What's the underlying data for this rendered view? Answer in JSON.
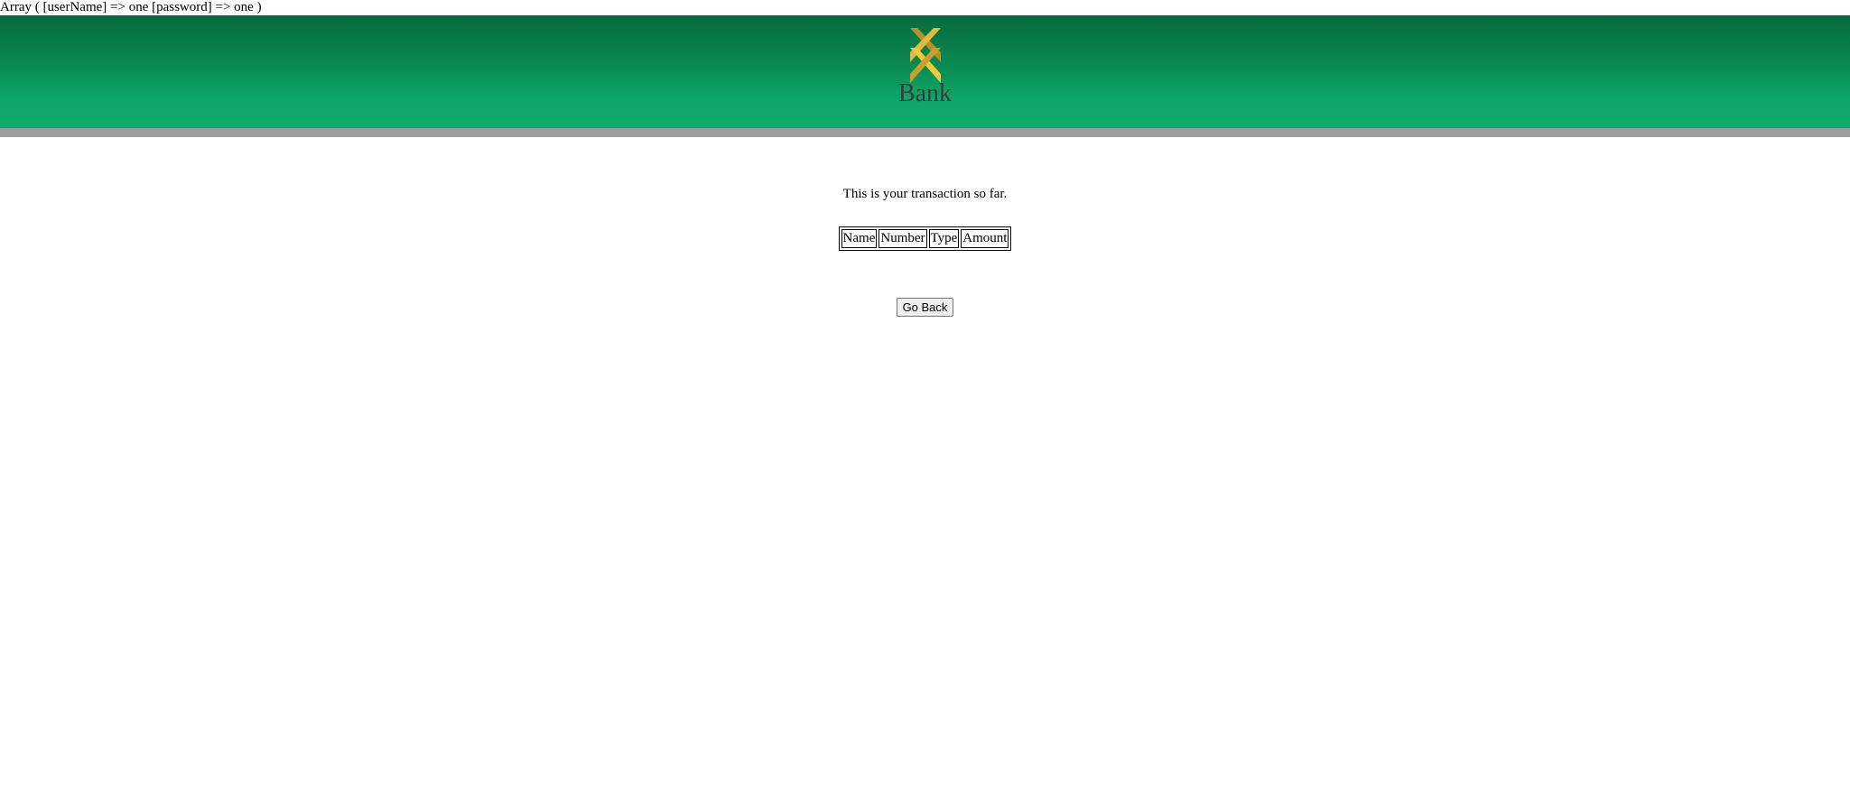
{
  "debug_output": "Array ( [userName] => one [password] => one )",
  "header": {
    "logo_icon": "bank-logo-icon",
    "logo_text": "Bank",
    "colors": {
      "gradient_top": "#076a3e",
      "gradient_bottom": "#0faa6c",
      "bar": "#9c9c9c",
      "logo_gold": "#e0b62b"
    }
  },
  "main": {
    "message": "This is your transaction so far.",
    "table": {
      "headers": [
        "Name",
        "Number",
        "Type",
        "Amount"
      ],
      "rows": []
    },
    "go_back_label": "Go Back"
  }
}
